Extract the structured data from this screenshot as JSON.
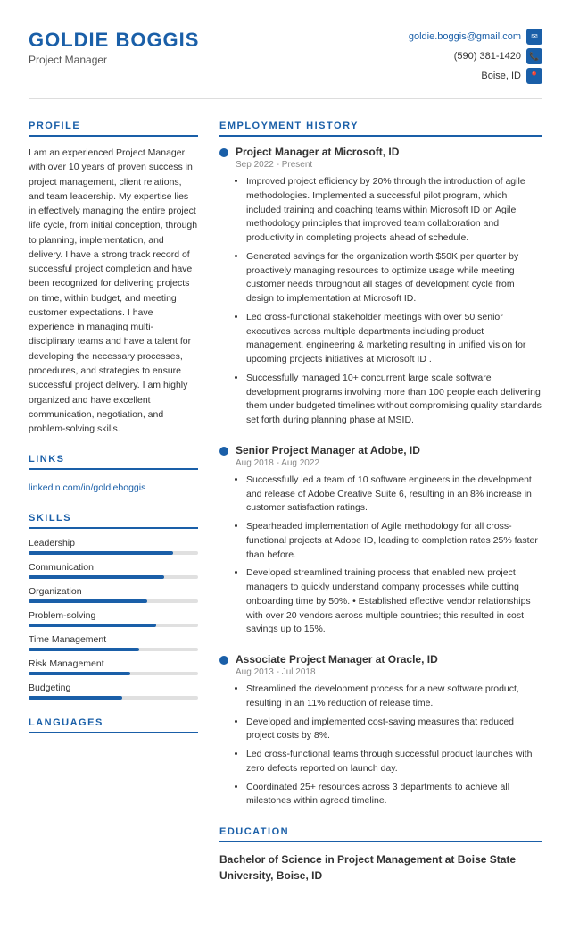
{
  "header": {
    "name": "GOLDIE BOGGIS",
    "title": "Project Manager",
    "email": "goldie.boggis@gmail.com",
    "phone": "(590) 381-1420",
    "location": "Boise, ID"
  },
  "profile": {
    "section_title": "PROFILE",
    "text": "I am an experienced Project Manager with over 10 years of proven success in project management, client relations, and team leadership. My expertise lies in effectively managing the entire project life cycle, from initial conception, through to planning, implementation, and delivery. I have a strong track record of successful project completion and have been recognized for delivering projects on time, within budget, and meeting customer expectations. I have experience in managing multi-disciplinary teams and have a talent for developing the necessary processes, procedures, and strategies to ensure successful project delivery. I am highly organized and have excellent communication, negotiation, and problem-solving skills."
  },
  "links": {
    "section_title": "LINKS",
    "items": [
      {
        "label": "linkedin.com/in/goldieboggis",
        "url": "#"
      }
    ]
  },
  "skills": {
    "section_title": "SKILLS",
    "items": [
      {
        "name": "Leadership",
        "pct": 85
      },
      {
        "name": "Communication",
        "pct": 80
      },
      {
        "name": "Organization",
        "pct": 70
      },
      {
        "name": "Problem-solving",
        "pct": 75
      },
      {
        "name": "Time Management",
        "pct": 65
      },
      {
        "name": "Risk Management",
        "pct": 60
      },
      {
        "name": "Budgeting",
        "pct": 55
      }
    ]
  },
  "languages": {
    "section_title": "LANGUAGES"
  },
  "employment": {
    "section_title": "EMPLOYMENT HISTORY",
    "jobs": [
      {
        "title": "Project Manager at Microsoft, ID",
        "date": "Sep 2022 - Present",
        "bullets": [
          "Improved project efficiency by 20% through the introduction of agile methodologies. Implemented a successful pilot program, which included training and coaching teams within Microsoft ID on Agile methodology principles that improved team collaboration and productivity in completing projects ahead of schedule.",
          "Generated savings for the organization worth $50K per quarter by proactively managing resources to optimize usage while meeting customer needs throughout all stages of development cycle from design to implementation at Microsoft ID.",
          "Led cross-functional stakeholder meetings with over 50 senior executives across multiple departments including product management, engineering & marketing resulting in unified vision for upcoming projects initiatives at Microsoft ID .",
          "Successfully managed 10+ concurrent large scale software development programs involving more than 100 people each delivering them under budgeted timelines without compromising quality standards set forth during planning phase at MSID."
        ]
      },
      {
        "title": "Senior Project Manager at Adobe, ID",
        "date": "Aug 2018 - Aug 2022",
        "bullets": [
          "Successfully led a team of 10 software engineers in the development and release of Adobe Creative Suite 6, resulting in an 8% increase in customer satisfaction ratings.",
          "Spearheaded implementation of Agile methodology for all cross-functional projects at Adobe ID, leading to completion rates 25% faster than before.",
          "Developed streamlined training process that enabled new project managers to quickly understand company processes while cutting onboarding time by 50%. • Established effective vendor relationships with over 20 vendors across multiple countries; this resulted in cost savings up to 15%."
        ]
      },
      {
        "title": "Associate Project Manager at Oracle, ID",
        "date": "Aug 2013 - Jul 2018",
        "bullets": [
          "Streamlined the development process for a new software product, resulting in an 11% reduction of release time.",
          "Developed and implemented cost-saving measures that reduced project costs by 8%.",
          "Led cross-functional teams through successful product launches with zero defects reported on launch day.",
          "Coordinated 25+ resources across 3 departments to achieve all milestones within agreed timeline."
        ]
      }
    ]
  },
  "education": {
    "section_title": "EDUCATION",
    "degree": "Bachelor of Science in Project Management at Boise State University, Boise, ID"
  }
}
